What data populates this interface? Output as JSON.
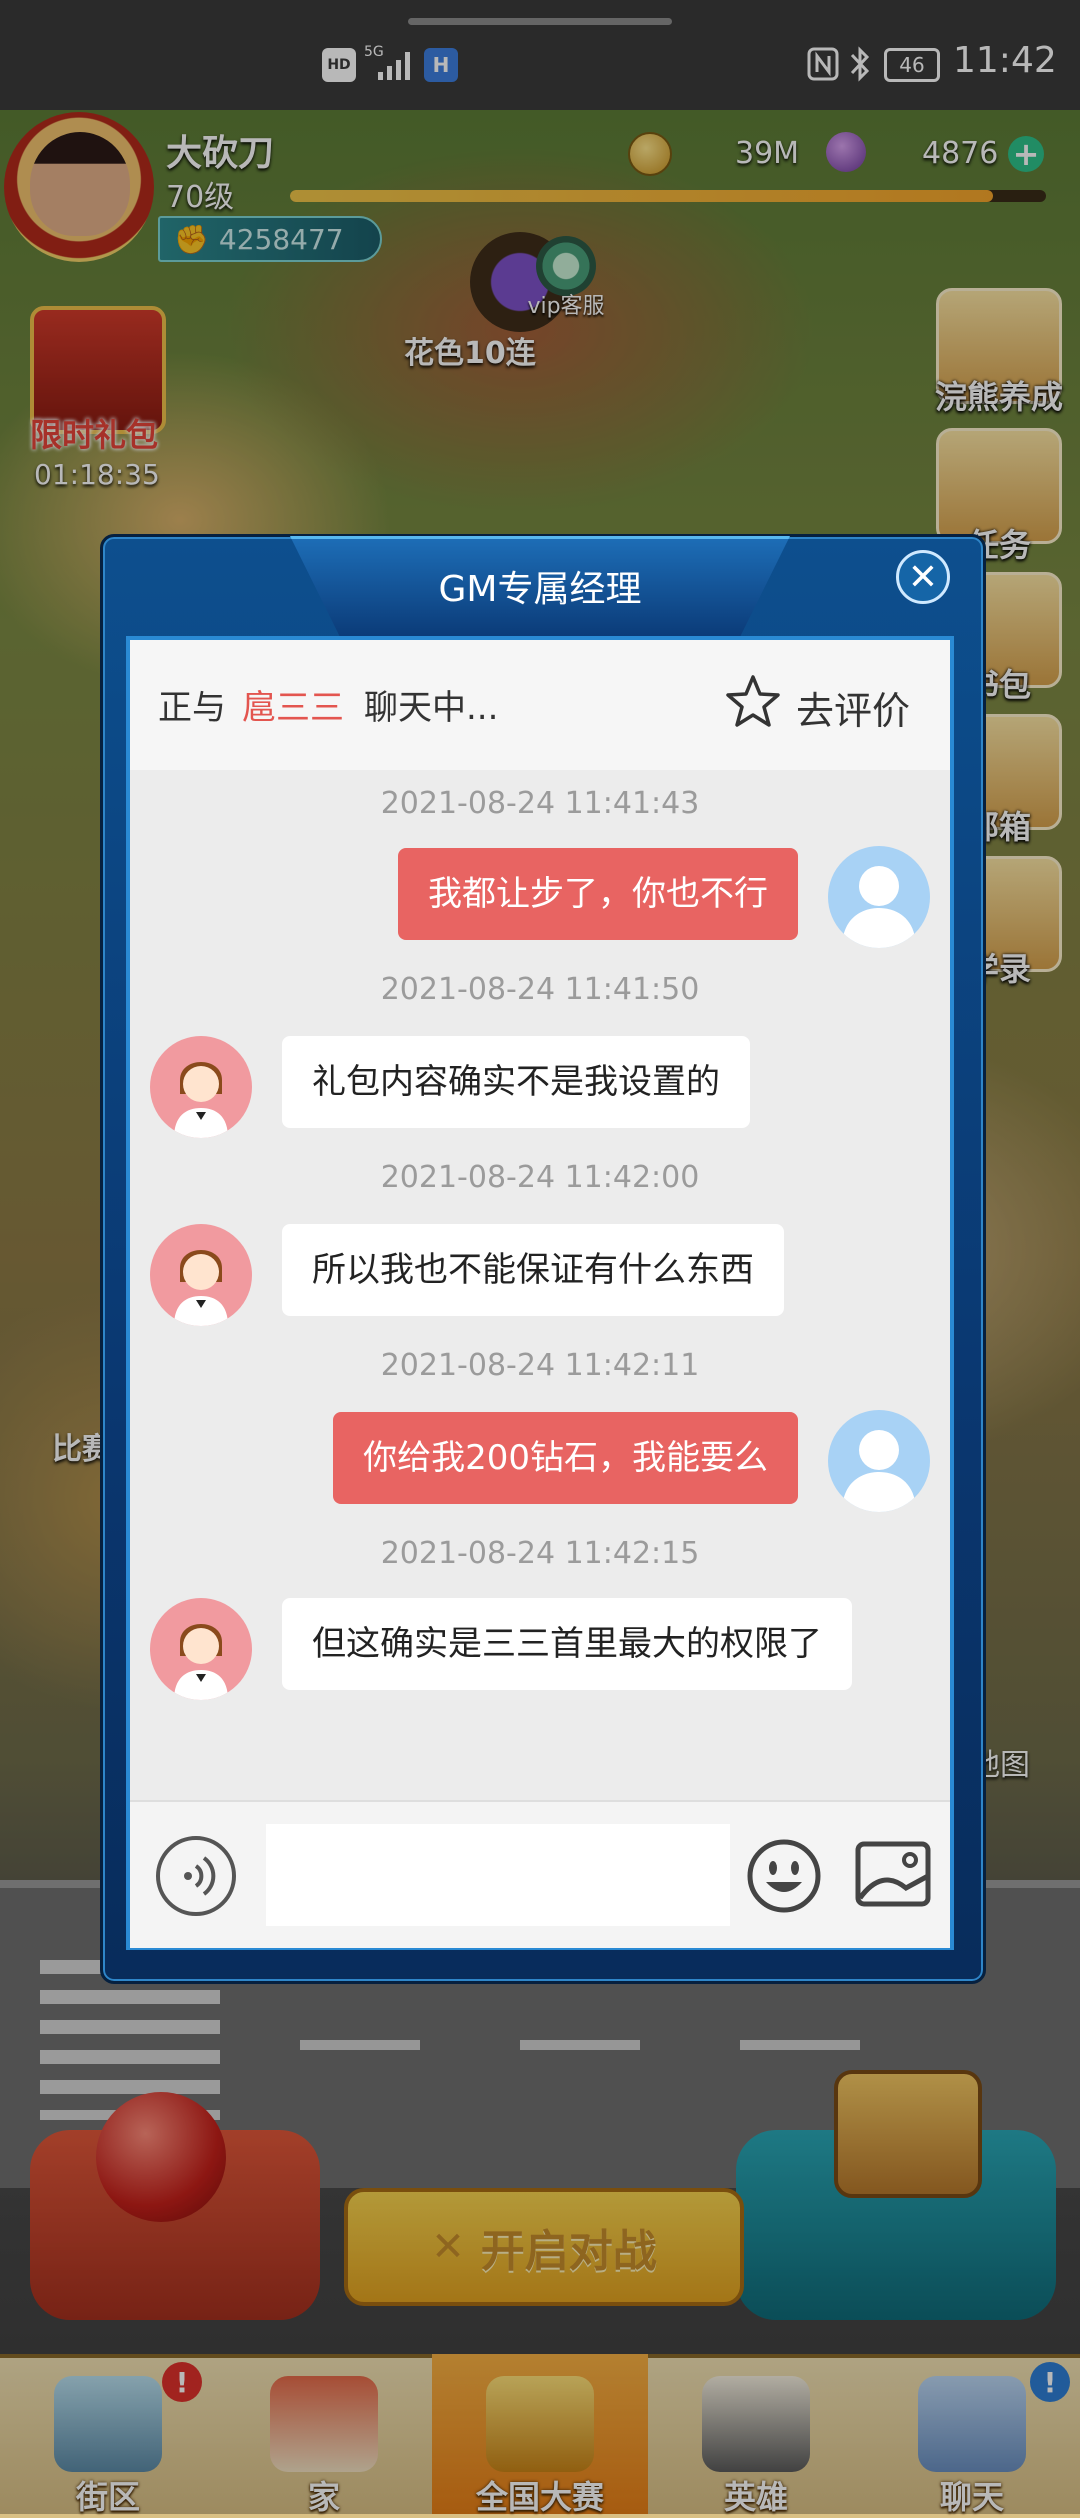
{
  "status_bar": {
    "hd": "HD",
    "network": "5G",
    "battery": "46",
    "time": "11:42"
  },
  "player": {
    "name": "大砍刀",
    "level": "70级",
    "power": "4258477",
    "gold": "39M",
    "gems": "4876",
    "xp_progress": 0.93
  },
  "map": {
    "vip_service": "vip客服",
    "flower_label": "花色10连",
    "limited_gift": "限时礼包",
    "gift_timer": "01:18:35",
    "side_buttons": [
      "浣熊养成",
      "任务",
      "书包",
      "邮箱",
      "学录"
    ],
    "map_label": "地图",
    "match_label": "比赛"
  },
  "dialog": {
    "title": "GM专属经理",
    "chat_with_prefix": "正与",
    "chat_with_name": "扈三三",
    "chat_with_suffix": "聊天中...",
    "rate_label": "去评价",
    "messages": [
      {
        "time": "2021-08-24 11:41:43",
        "from": "me",
        "text": "我都让步了，你也不行"
      },
      {
        "time": "2021-08-24 11:41:50",
        "from": "gm",
        "text": "礼包内容确实不是我设置的"
      },
      {
        "time": "2021-08-24 11:42:00",
        "from": "gm",
        "text": "所以我也不能保证有什么东西"
      },
      {
        "time": "2021-08-24 11:42:11",
        "from": "me",
        "text": "你给我200钻石，我能要么"
      },
      {
        "time": "2021-08-24 11:42:15",
        "from": "gm",
        "text": "但这确实是三三首里最大的权限了"
      }
    ],
    "input_placeholder": ""
  },
  "controls": {
    "battle_label": "开启对战"
  },
  "bottom_nav": {
    "items": [
      {
        "label": "街区",
        "badge": "!"
      },
      {
        "label": "家",
        "badge": ""
      },
      {
        "label": "全国大赛",
        "badge": "",
        "active": true
      },
      {
        "label": "英雄",
        "badge": ""
      },
      {
        "label": "聊天",
        "badge": "!"
      }
    ]
  },
  "colors": {
    "accent_red": "#e86462",
    "gm_name_red": "#e3554f",
    "dialog_blue": "#0d4f8e"
  }
}
